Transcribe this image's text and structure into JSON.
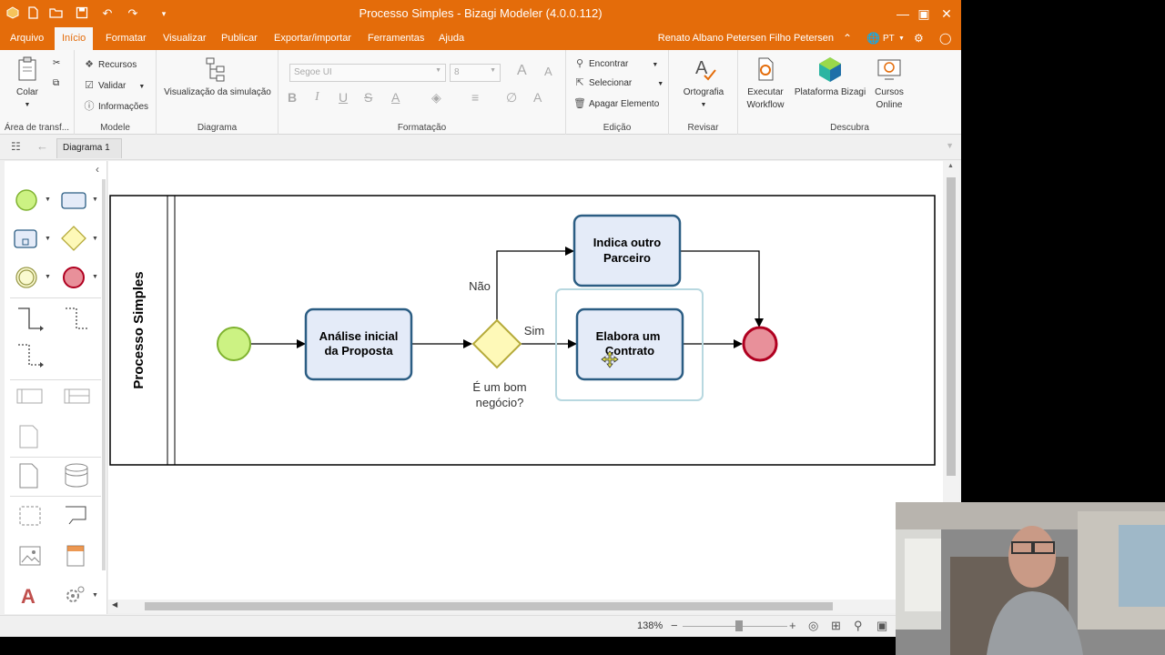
{
  "window": {
    "title": "Processo Simples - Bizagi Modeler (4.0.0.112)"
  },
  "menu": {
    "items": [
      "Arquivo",
      "Início",
      "Formatar",
      "Visualizar",
      "Publicar",
      "Exportar/importar",
      "Ferramentas",
      "Ajuda"
    ],
    "active": "Início",
    "user": "Renato Albano Petersen Filho Petersen",
    "language": "PT"
  },
  "ribbon": {
    "clipboard": {
      "paste": "Colar",
      "label": "Área de transf..."
    },
    "model": {
      "resources": "Recursos",
      "validate": "Validar",
      "info": "Informações",
      "label": "Modele"
    },
    "diagram": {
      "simulation": "Visualização da simulação",
      "label": "Diagrama"
    },
    "format": {
      "font": "Segoe UI",
      "size": "8",
      "label": "Formatação"
    },
    "edit": {
      "find": "Encontrar",
      "select": "Selecionar",
      "delete": "Apagar Elemento",
      "label": "Edição"
    },
    "review": {
      "spelling": "Ortografia",
      "label": "Revisar"
    },
    "discover": {
      "workflow_line1": "Executar",
      "workflow_line2": "Workflow",
      "platform": "Plataforma Bizagi",
      "courses_line1": "Cursos",
      "courses_line2": "Online",
      "label": "Descubra"
    }
  },
  "tabs": {
    "diagram": "Diagrama 1"
  },
  "diagram": {
    "pool_name": "Processo Simples",
    "task_analysis_line1": "Análise inicial",
    "task_analysis_line2": "da Proposta",
    "task_partner_line1": "Indica outro",
    "task_partner_line2": "Parceiro",
    "task_contract_line1": "Elabora um",
    "task_contract_line2": "Contrato",
    "gateway_line1": "É um bom",
    "gateway_line2": "negócio?",
    "flow_no": "Não",
    "flow_yes": "Sim"
  },
  "status": {
    "zoom": "138%"
  },
  "colors": {
    "orange": "#e46c0a",
    "start_fill": "#ccf283",
    "end_fill": "#e8909a",
    "task_fill": "#e4ebf8",
    "task_stroke": "#2b5d83",
    "gateway_fill": "#fef9b8"
  }
}
